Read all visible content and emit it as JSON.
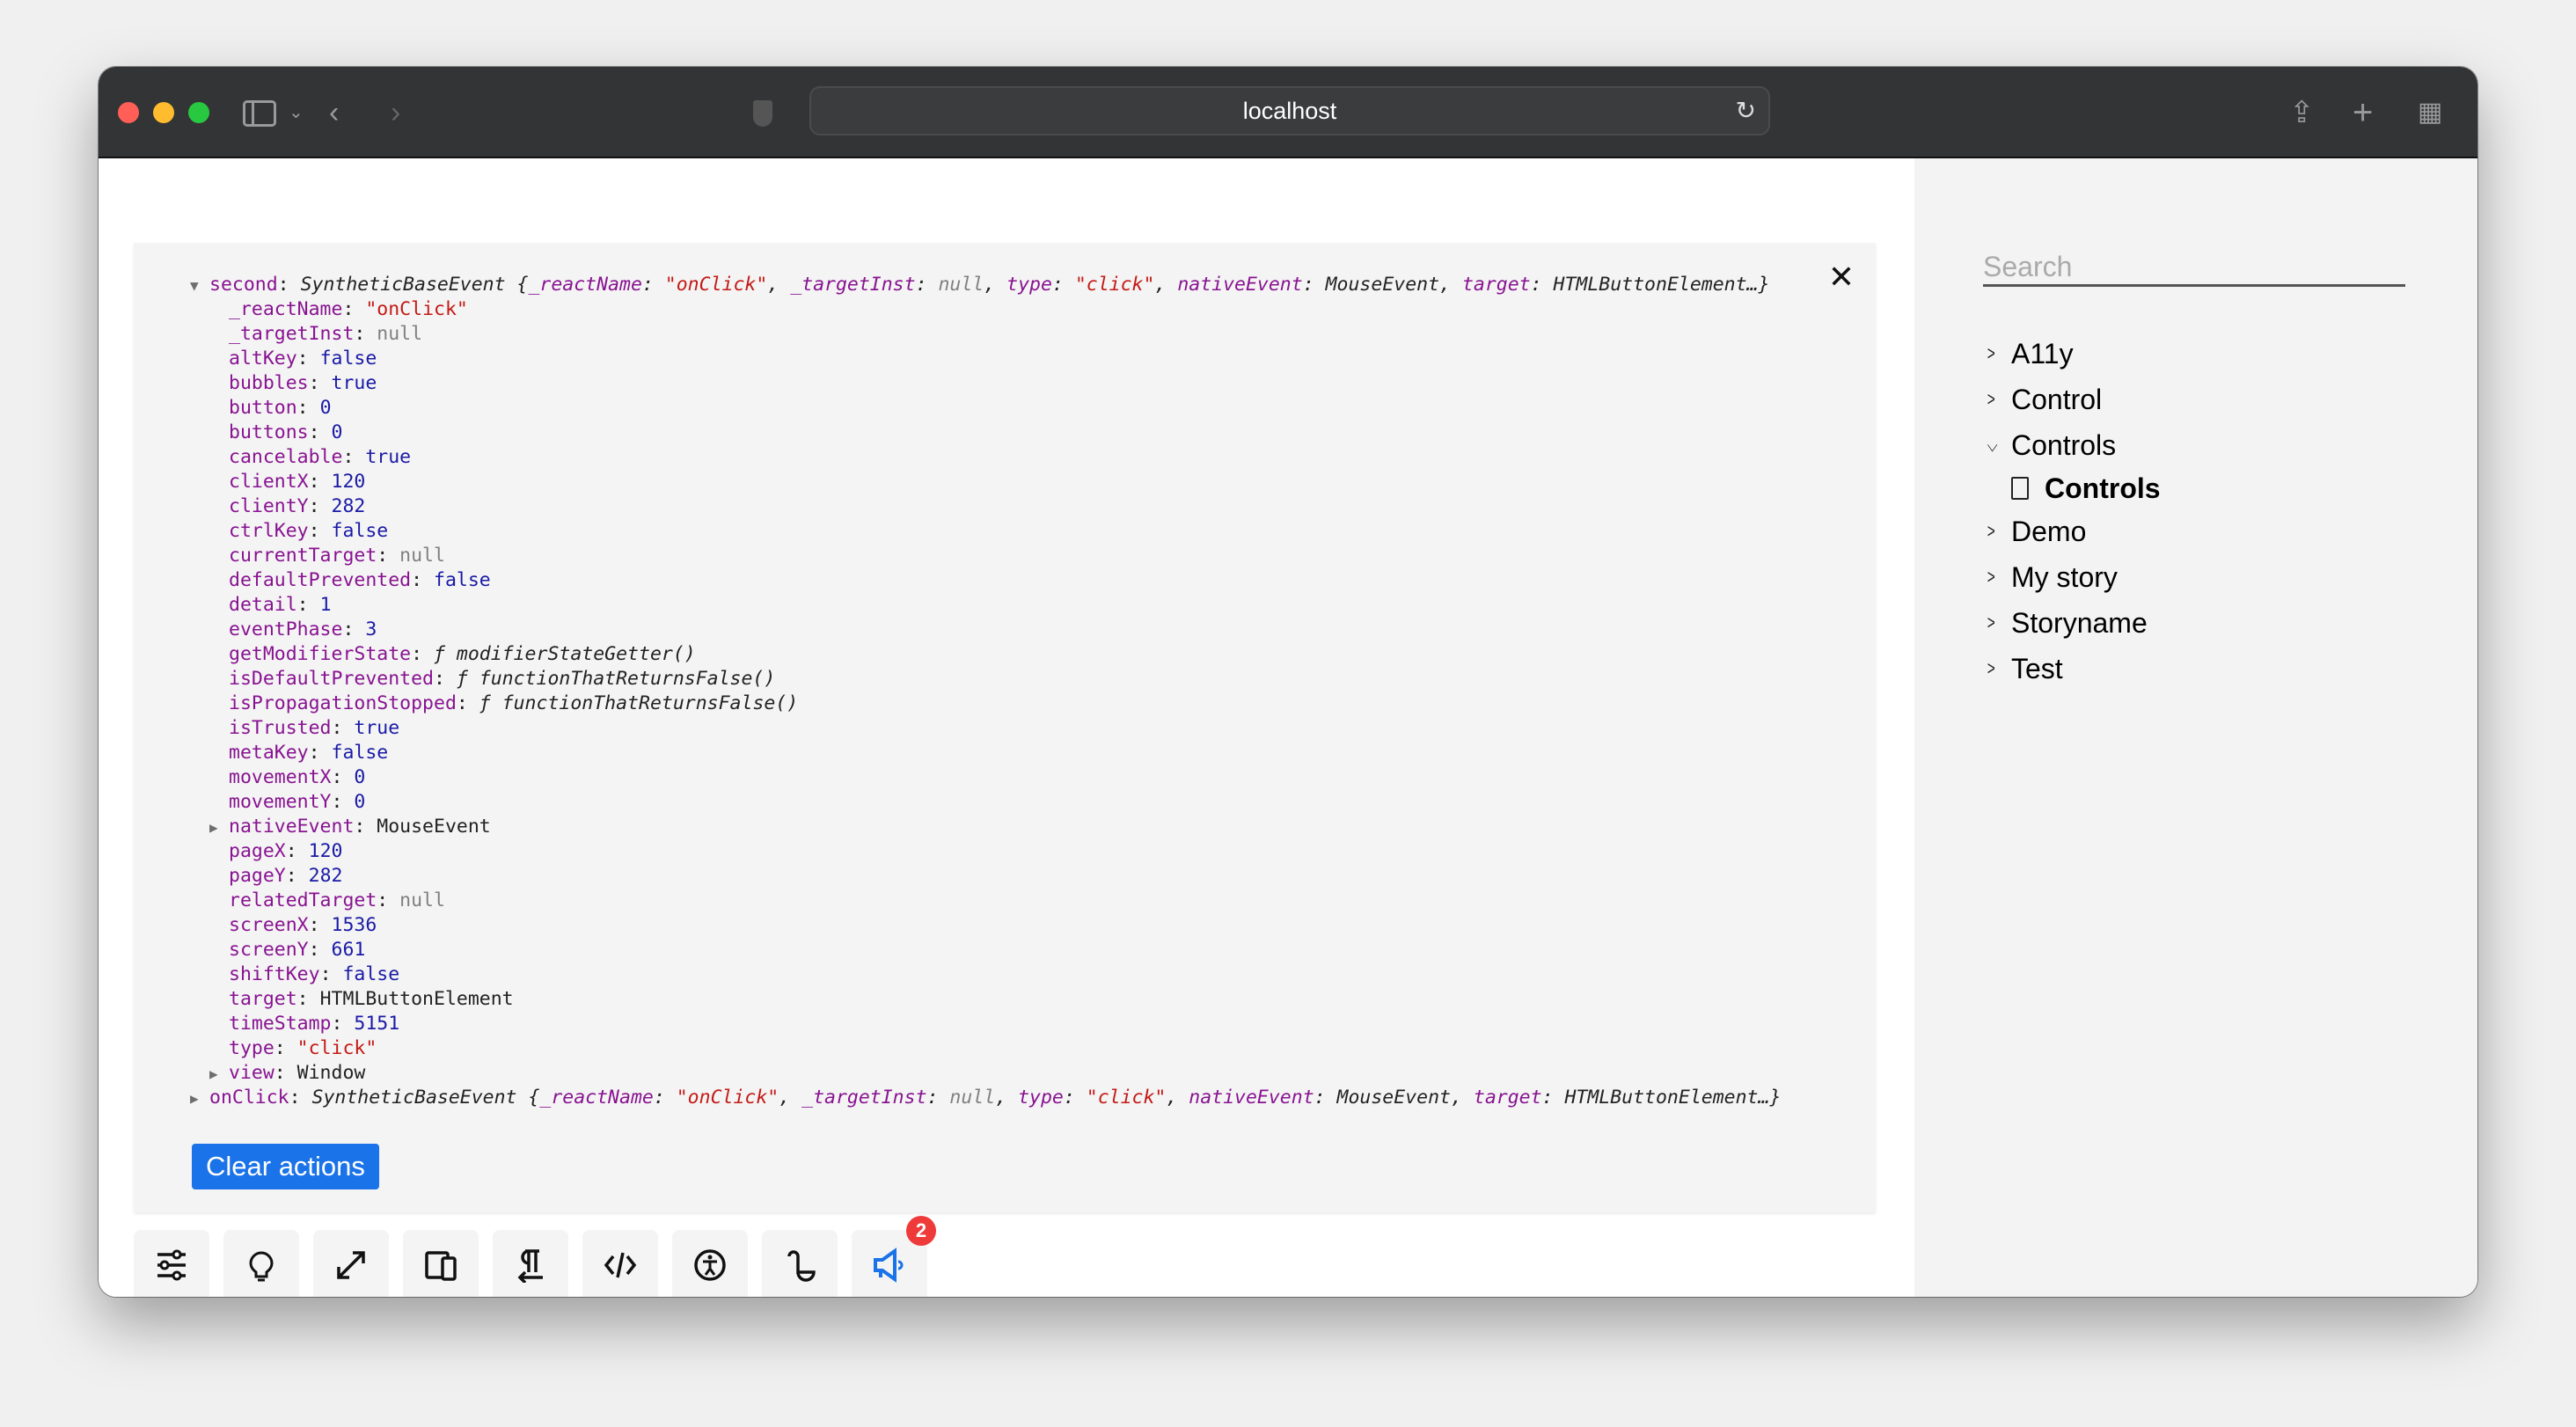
{
  "browser": {
    "url": "localhost",
    "colors": {
      "close": "#ff5f57",
      "minimize": "#febc2e",
      "maximize": "#28c840"
    }
  },
  "console": {
    "root": {
      "key": "second",
      "cls": "SyntheticBaseEvent",
      "preview": [
        [
          "k",
          "_reactName"
        ],
        [
          "s",
          "\"onClick\""
        ],
        [
          "k",
          "_targetInst"
        ],
        [
          "n",
          "null"
        ],
        [
          "k",
          "type"
        ],
        [
          "s",
          "\"click\""
        ],
        [
          "k",
          "nativeEvent"
        ],
        [
          "o",
          "MouseEvent"
        ],
        [
          "k",
          "target"
        ],
        [
          "o",
          "HTMLButtonElement…"
        ]
      ]
    },
    "props": [
      {
        "k": "_reactName",
        "v": "\"onClick\"",
        "t": "s"
      },
      {
        "k": "_targetInst",
        "v": "null",
        "t": "n"
      },
      {
        "k": "altKey",
        "v": "false",
        "t": "b"
      },
      {
        "k": "bubbles",
        "v": "true",
        "t": "b"
      },
      {
        "k": "button",
        "v": "0",
        "t": "b"
      },
      {
        "k": "buttons",
        "v": "0",
        "t": "b"
      },
      {
        "k": "cancelable",
        "v": "true",
        "t": "b"
      },
      {
        "k": "clientX",
        "v": "120",
        "t": "b"
      },
      {
        "k": "clientY",
        "v": "282",
        "t": "b"
      },
      {
        "k": "ctrlKey",
        "v": "false",
        "t": "b"
      },
      {
        "k": "currentTarget",
        "v": "null",
        "t": "n"
      },
      {
        "k": "defaultPrevented",
        "v": "false",
        "t": "b"
      },
      {
        "k": "detail",
        "v": "1",
        "t": "b"
      },
      {
        "k": "eventPhase",
        "v": "3",
        "t": "b"
      },
      {
        "k": "getModifierState",
        "v": "ƒ modifierStateGetter()",
        "t": "f"
      },
      {
        "k": "isDefaultPrevented",
        "v": "ƒ functionThatReturnsFalse()",
        "t": "f"
      },
      {
        "k": "isPropagationStopped",
        "v": "ƒ functionThatReturnsFalse()",
        "t": "f"
      },
      {
        "k": "isTrusted",
        "v": "true",
        "t": "b"
      },
      {
        "k": "metaKey",
        "v": "false",
        "t": "b"
      },
      {
        "k": "movementX",
        "v": "0",
        "t": "b"
      },
      {
        "k": "movementY",
        "v": "0",
        "t": "b"
      },
      {
        "k": "nativeEvent",
        "v": "MouseEvent",
        "t": "o",
        "expandable": true
      },
      {
        "k": "pageX",
        "v": "120",
        "t": "b"
      },
      {
        "k": "pageY",
        "v": "282",
        "t": "b"
      },
      {
        "k": "relatedTarget",
        "v": "null",
        "t": "n"
      },
      {
        "k": "screenX",
        "v": "1536",
        "t": "b"
      },
      {
        "k": "screenY",
        "v": "661",
        "t": "b"
      },
      {
        "k": "shiftKey",
        "v": "false",
        "t": "b"
      },
      {
        "k": "target",
        "v": "HTMLButtonElement",
        "t": "o"
      },
      {
        "k": "timeStamp",
        "v": "5151",
        "t": "b"
      },
      {
        "k": "type",
        "v": "\"click\"",
        "t": "s"
      },
      {
        "k": "view",
        "v": "Window",
        "t": "o",
        "expandable": true
      }
    ],
    "second": {
      "key": "onClick",
      "cls": "SyntheticBaseEvent",
      "preview": [
        [
          "k",
          "_reactName"
        ],
        [
          "s",
          "\"onClick\""
        ],
        [
          "k",
          "_targetInst"
        ],
        [
          "n",
          "null"
        ],
        [
          "k",
          "type"
        ],
        [
          "s",
          "\"click\""
        ],
        [
          "k",
          "nativeEvent"
        ],
        [
          "o",
          "MouseEvent"
        ],
        [
          "k",
          "target"
        ],
        [
          "o",
          "HTMLButtonElement…"
        ]
      ]
    }
  },
  "actions": {
    "clear_label": "Clear actions"
  },
  "addons": {
    "badge_count": "2",
    "icons": [
      "controls-icon",
      "lightbulb-icon",
      "fullscreen-icon",
      "viewport-icon",
      "text-direction-icon",
      "code-icon",
      "accessibility-icon",
      "measure-icon",
      "actions-megaphone-icon"
    ],
    "active_color": "#1a73e8"
  },
  "sidebar": {
    "search_placeholder": "Search",
    "items": [
      {
        "label": "A11y",
        "expanded": false
      },
      {
        "label": "Control",
        "expanded": false
      },
      {
        "label": "Controls",
        "expanded": true,
        "children": [
          {
            "label": "Controls",
            "selected": true
          }
        ]
      },
      {
        "label": "Demo",
        "expanded": false
      },
      {
        "label": "My story",
        "expanded": false
      },
      {
        "label": "Storyname",
        "expanded": false
      },
      {
        "label": "Test",
        "expanded": false
      }
    ]
  }
}
